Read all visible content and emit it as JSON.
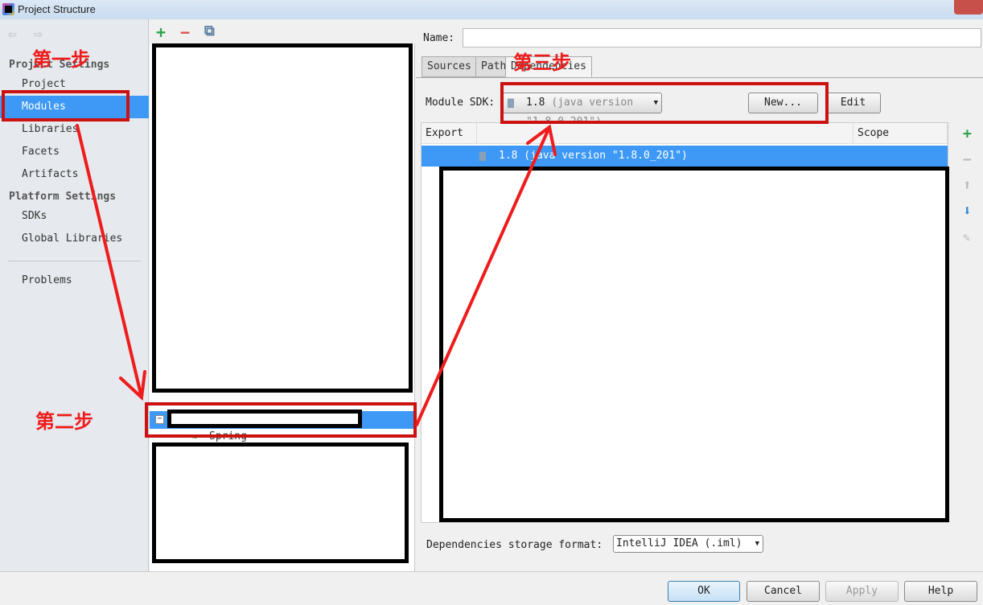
{
  "window": {
    "title": "Project Structure"
  },
  "sidebar": {
    "back": "⇦",
    "forward": "⇨",
    "project_settings": "Project Settings",
    "items": [
      {
        "label": "Project"
      },
      {
        "label": "Modules",
        "selected": true
      },
      {
        "label": "Libraries"
      },
      {
        "label": "Facets"
      },
      {
        "label": "Artifacts"
      }
    ],
    "platform_settings": "Platform Settings",
    "platform_items": [
      {
        "label": "SDKs"
      },
      {
        "label": "Global Libraries"
      }
    ],
    "problems": "Problems"
  },
  "middle": {
    "add": "+",
    "remove": "−",
    "copy": "⧉",
    "tree_child": "Spring"
  },
  "right": {
    "name_label": "Name:",
    "name_value": "",
    "tabs": [
      {
        "label": "Sources"
      },
      {
        "label": "Paths"
      },
      {
        "label": "Dependencies",
        "selected": true
      }
    ],
    "module_sdk_label": "Module SDK:",
    "sdk_version": "1.8",
    "sdk_detail": "(java version \"1.8.0_201\")",
    "new_button": "New...",
    "edit_button": "Edit",
    "table": {
      "headers": [
        "Export",
        "",
        "Scope"
      ],
      "rows": [
        {
          "name": "1.8 (java version \"1.8.0_201\")",
          "selected": true
        }
      ]
    },
    "storage_label": "Dependencies storage format:",
    "storage_value": "IntelliJ IDEA (.iml)"
  },
  "buttons": {
    "ok": "OK",
    "cancel": "Cancel",
    "apply": "Apply",
    "help": "Help"
  },
  "annotations": {
    "step1": "第一步",
    "step2": "第二步",
    "step3": "第三步",
    "color": "#ee1c1c"
  },
  "colors": {
    "selection": "#3d99f5",
    "add": "#2da44e",
    "remove": "#d9534f"
  }
}
